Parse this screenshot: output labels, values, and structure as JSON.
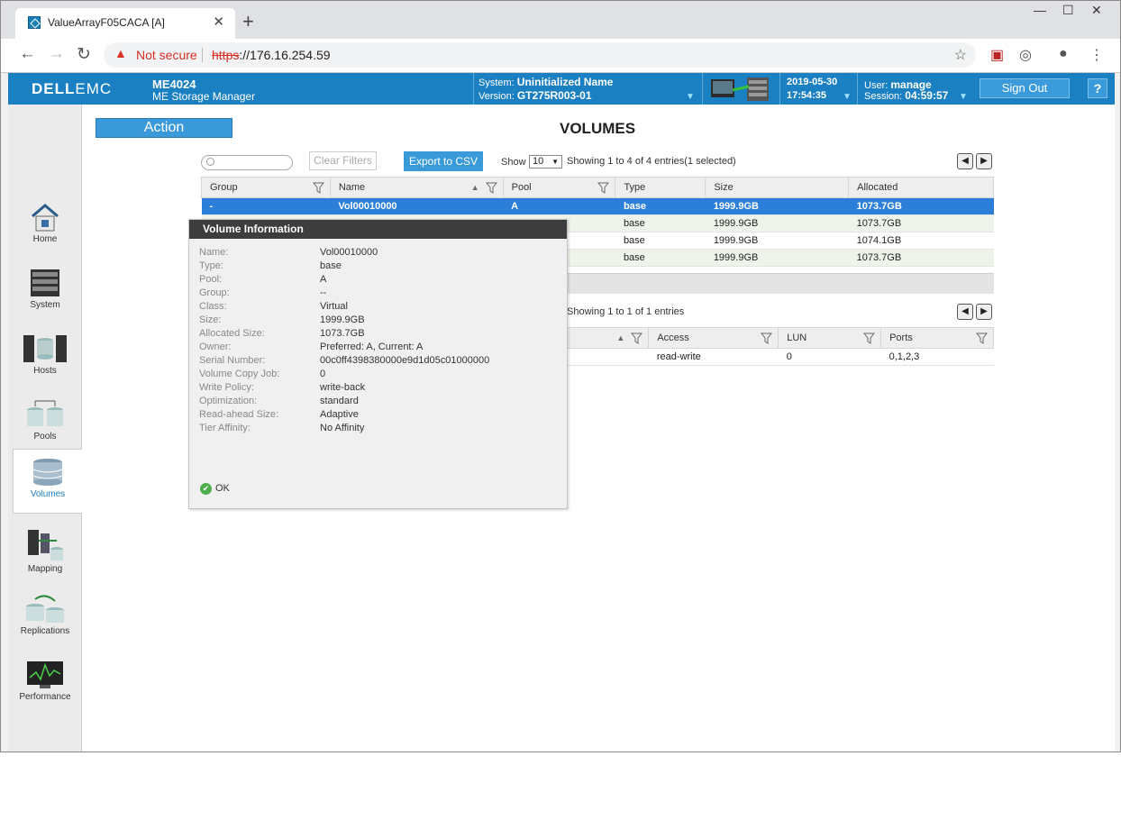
{
  "browser": {
    "tab_title": "ValueArrayF05CACA [A]",
    "not_secure": "Not secure",
    "url_scheme": "https",
    "url_rest": "://176.16.254.59"
  },
  "header": {
    "logo_a": "DELL",
    "logo_b": "EMC",
    "model": "ME4024",
    "manager": "ME Storage Manager",
    "system_label": "System:",
    "system_value": "Uninitialized Name",
    "version_label": "Version:",
    "version_value": "GT275R003-01",
    "date": "2019-05-30",
    "time": "17:54:35",
    "user_label": "User:",
    "user_value": "manage",
    "session_label": "Session:",
    "session_value": "04:59:57",
    "sign_out": "Sign Out",
    "help": "?"
  },
  "nav": {
    "items": [
      {
        "label": "Home"
      },
      {
        "label": "System"
      },
      {
        "label": "Hosts"
      },
      {
        "label": "Pools"
      },
      {
        "label": "Volumes"
      },
      {
        "label": "Mapping"
      },
      {
        "label": "Replications"
      },
      {
        "label": "Performance"
      }
    ]
  },
  "toolbar": {
    "action": "Action",
    "title": "VOLUMES",
    "clear_filters": "Clear Filters",
    "export_csv": "Export to CSV",
    "show": "Show",
    "show_value": "10",
    "showing": "Showing 1 to 4 of 4 entries(1 selected)"
  },
  "volumes": {
    "headers": [
      "Group",
      "Name",
      "Pool",
      "Type",
      "Size",
      "Allocated"
    ],
    "rows": [
      [
        "-",
        "Vol00010000",
        "A",
        "base",
        "1999.9GB",
        "1073.7GB"
      ],
      [
        "",
        "",
        "",
        "base",
        "1999.9GB",
        "1073.7GB"
      ],
      [
        "",
        "",
        "",
        "base",
        "1999.9GB",
        "1074.1GB"
      ],
      [
        "",
        "",
        "",
        "base",
        "1999.9GB",
        "1073.7GB"
      ]
    ]
  },
  "mapping": {
    "showing": "Showing 1 to 1 of 1 entries",
    "headers": [
      "Access",
      "LUN",
      "Ports"
    ],
    "row": [
      "read-write",
      "0",
      "0,1,2,3"
    ]
  },
  "popup": {
    "title": "Volume Information",
    "fields": [
      [
        "Name:",
        "Vol00010000"
      ],
      [
        "Type:",
        "base"
      ],
      [
        "Pool:",
        "A"
      ],
      [
        "Group:",
        "--"
      ],
      [
        "Class:",
        "Virtual"
      ],
      [
        "Size:",
        "1999.9GB"
      ],
      [
        "Allocated Size:",
        "1073.7GB"
      ],
      [
        "Owner:",
        "Preferred: A, Current: A"
      ],
      [
        "Serial Number:",
        "00c0ff4398380000e9d1d05c01000000"
      ],
      [
        "Volume Copy Job:",
        "0"
      ],
      [
        "Write Policy:",
        "write-back"
      ],
      [
        "Optimization:",
        "standard"
      ],
      [
        "Read-ahead Size:",
        "Adaptive"
      ],
      [
        "Tier Affinity:",
        "No Affinity"
      ]
    ],
    "ok": "OK"
  }
}
